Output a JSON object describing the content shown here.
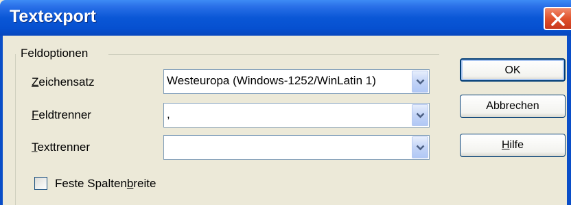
{
  "window": {
    "title": "Textexport"
  },
  "group": {
    "label": "Feldoptionen"
  },
  "fields": {
    "zeichensatz": {
      "label_pre": "",
      "label_acc": "Z",
      "label_post": "eichensatz",
      "value": "Westeuropa (Windows-1252/WinLatin 1)"
    },
    "feldtrenner": {
      "label_pre": "",
      "label_acc": "F",
      "label_post": "eldtrenner",
      "value": ","
    },
    "texttrenner": {
      "label_pre": "",
      "label_acc": "T",
      "label_post": "exttrenner",
      "value": ""
    }
  },
  "checkbox": {
    "label_pre": "Feste Spalten",
    "label_acc": "b",
    "label_post": "reite",
    "checked": false
  },
  "buttons": {
    "ok": "OK",
    "cancel": "Abbrechen",
    "help_acc": "H",
    "help_post": "ilfe"
  },
  "icons": {
    "close": "close-icon",
    "dropdown": "chevron-down-icon"
  }
}
